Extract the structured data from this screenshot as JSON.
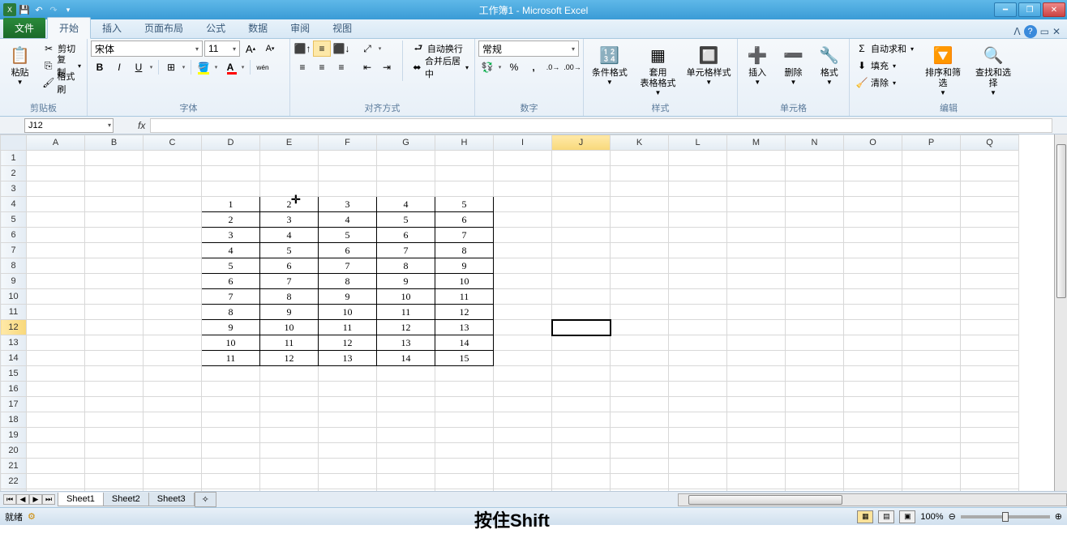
{
  "title": "工作簿1 - Microsoft Excel",
  "tabs": {
    "file": "文件",
    "home": "开始",
    "insert": "插入",
    "layout": "页面布局",
    "formulas": "公式",
    "data": "数据",
    "review": "审阅",
    "view": "视图"
  },
  "clipboard": {
    "paste": "粘贴",
    "cut": "剪切",
    "copy": "复制",
    "painter": "格式刷",
    "group": "剪贴板"
  },
  "font": {
    "name": "宋体",
    "size": "11",
    "group": "字体"
  },
  "align": {
    "wrap": "自动换行",
    "merge": "合并后居中",
    "group": "对齐方式"
  },
  "number": {
    "format": "常规",
    "group": "数字"
  },
  "styles": {
    "cond": "条件格式",
    "table": "套用\n表格格式",
    "cell": "单元格样式",
    "group": "样式"
  },
  "cells": {
    "insert": "插入",
    "delete": "删除",
    "format": "格式",
    "group": "单元格"
  },
  "editing": {
    "sum": "自动求和",
    "fill": "填充",
    "clear": "清除",
    "sort": "排序和筛选",
    "find": "查找和选择",
    "group": "编辑"
  },
  "namebox": "J12",
  "columns": [
    "A",
    "B",
    "C",
    "D",
    "E",
    "F",
    "G",
    "H",
    "I",
    "J",
    "K",
    "L",
    "M",
    "N",
    "O",
    "P",
    "Q"
  ],
  "rowcount": 23,
  "activeCell": {
    "row": 12,
    "col": "J"
  },
  "dataRegion": {
    "startCol": 3,
    "startRow": 4,
    "rows": [
      [
        1,
        2,
        3,
        4,
        5
      ],
      [
        2,
        3,
        4,
        5,
        6
      ],
      [
        3,
        4,
        5,
        6,
        7
      ],
      [
        4,
        5,
        6,
        7,
        8
      ],
      [
        5,
        6,
        7,
        8,
        9
      ],
      [
        6,
        7,
        8,
        9,
        10
      ],
      [
        7,
        8,
        9,
        10,
        11
      ],
      [
        8,
        9,
        10,
        11,
        12
      ],
      [
        9,
        10,
        11,
        12,
        13
      ],
      [
        10,
        11,
        12,
        13,
        14
      ],
      [
        11,
        12,
        13,
        14,
        15
      ]
    ]
  },
  "sheets": [
    "Sheet1",
    "Sheet2",
    "Sheet3"
  ],
  "status": "就绪",
  "zoom": "100%",
  "overlay": "按住Shift"
}
